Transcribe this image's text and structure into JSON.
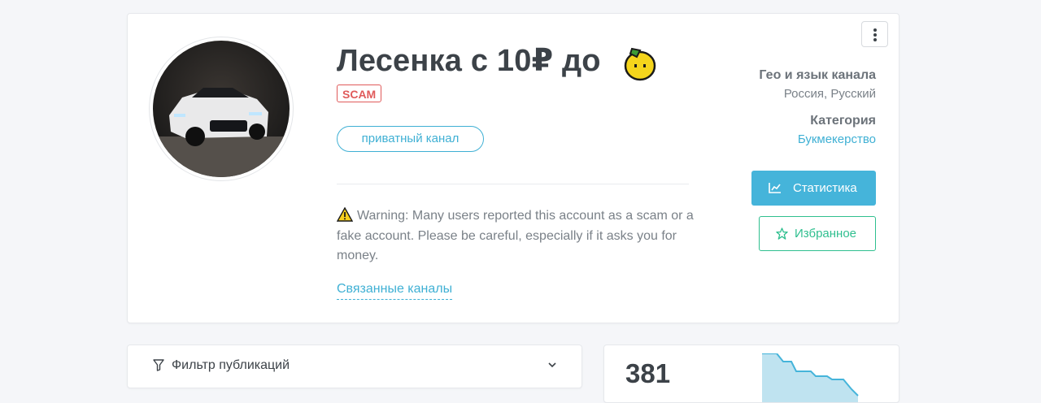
{
  "channel": {
    "title": "Лесенка с 10₽ до",
    "title_emoji": "lemon-emoji",
    "scam_badge": "SCAM",
    "private_label": "приватный канал",
    "warning_text": "Warning: Many users reported this account as a scam or a fake account. Please be careful, especially if it asks you for money.",
    "related_link": "Связанные каналы"
  },
  "sidebar": {
    "geo_label": "Гео и язык канала",
    "geo_value": "Россия, Русский",
    "category_label": "Категория",
    "category_value": "Букмекерство",
    "stats_button": "Статистика",
    "favorite_button": "Избранное"
  },
  "filter": {
    "label": "Фильтр публикаций"
  },
  "stats_card": {
    "count": "381"
  },
  "colors": {
    "accent": "#45b4da",
    "danger": "#e05a5a",
    "success": "#2fbf8f",
    "text": "#3c4248"
  },
  "icons": [
    "more-vertical-icon",
    "chart-icon",
    "star-icon",
    "filter-icon",
    "chevron-down-icon",
    "warning-icon"
  ]
}
